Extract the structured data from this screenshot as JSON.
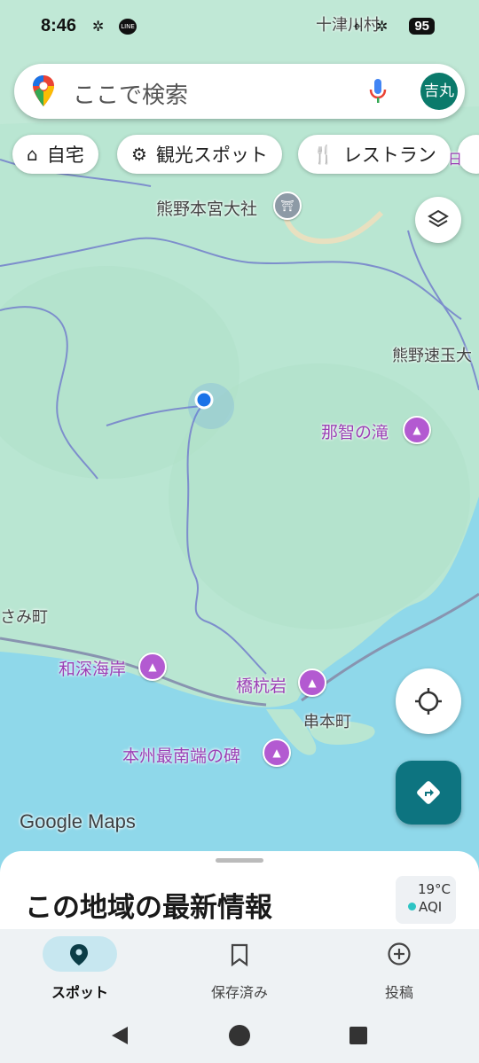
{
  "status": {
    "time": "8:46",
    "battery": "95",
    "top_place": "十津川村"
  },
  "search": {
    "placeholder": "ここで検索",
    "avatar": "吉丸"
  },
  "chips": [
    {
      "label": "自宅",
      "icon": "home-icon"
    },
    {
      "label": "観光スポット",
      "icon": "attraction-icon"
    },
    {
      "label": "レストラン",
      "icon": "restaurant-icon"
    }
  ],
  "map": {
    "places": {
      "hongu": "熊野本宮大社",
      "hayatama": "熊野速玉大",
      "nachi": "那智の滝",
      "susami": "さみ町",
      "wabuka": "和深海岸",
      "hashikui": "橋杭岩",
      "kushimoto": "串本町",
      "southern_tip": "本州最南端の碑",
      "shingu_partial": "日"
    },
    "watermark": "Google Maps",
    "colors": {
      "land": "#b9e6d2",
      "sea": "#8fd8ea",
      "poi": "#b35ad1",
      "accent": "#0d7480"
    }
  },
  "sheet": {
    "title": "この地域の最新情報",
    "temp": "19°C",
    "aqi": "AQI"
  },
  "nav": {
    "explore": "スポット",
    "saved": "保存済み",
    "contribute": "投稿"
  }
}
